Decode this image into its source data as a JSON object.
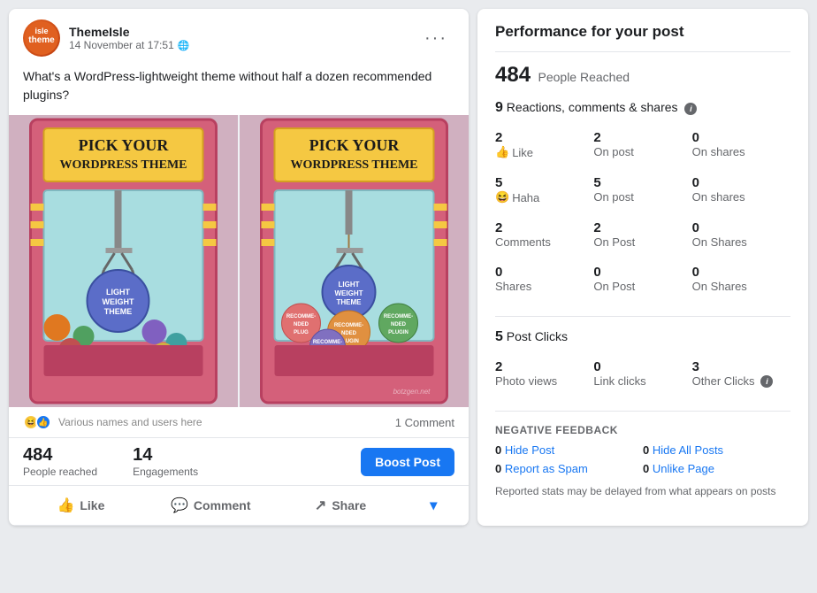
{
  "post": {
    "author": "ThemeIsle",
    "time": "14 November at 17:51",
    "text_line1": "What's a WordPress-lightweight theme without half a dozen recommended",
    "text_line2": "plugins?",
    "reach_number": "484",
    "reach_label": "People reached",
    "engagements_number": "14",
    "engagements_label": "Engagements",
    "boost_btn": "Boost Post",
    "comment_count": "1 Comment",
    "actions": {
      "like": "Like",
      "comment": "Comment",
      "share": "Share"
    }
  },
  "performance": {
    "title": "Performance for your post",
    "people_reached": "484",
    "people_reached_label": "People Reached",
    "reactions_count": "9",
    "reactions_label": "Reactions, comments & shares",
    "like_row": {
      "total": "2",
      "label": "Like",
      "on_post_num": "2",
      "on_post_label": "On post",
      "on_shares_num": "0",
      "on_shares_label": "On shares"
    },
    "haha_row": {
      "total": "5",
      "label": "Haha",
      "on_post_num": "5",
      "on_post_label": "On post",
      "on_shares_num": "0",
      "on_shares_label": "On shares"
    },
    "comments_row": {
      "total": "2",
      "label": "Comments",
      "on_post_num": "2",
      "on_post_label": "On Post",
      "on_shares_num": "0",
      "on_shares_label": "On Shares"
    },
    "shares_row": {
      "total": "0",
      "label": "Shares",
      "on_post_num": "0",
      "on_post_label": "On Post",
      "on_shares_num": "0",
      "on_shares_label": "On Shares"
    },
    "post_clicks_count": "5",
    "post_clicks_label": "Post Clicks",
    "photo_views_num": "2",
    "photo_views_label": "Photo views",
    "link_clicks_num": "0",
    "link_clicks_label": "Link clicks",
    "other_clicks_num": "3",
    "other_clicks_label": "Other Clicks",
    "negative_title": "NEGATIVE FEEDBACK",
    "hide_post_num": "0",
    "hide_post_label": "Hide Post",
    "hide_all_num": "0",
    "hide_all_label": "Hide All Posts",
    "spam_num": "0",
    "spam_label": "Report as Spam",
    "unlike_num": "0",
    "unlike_label": "Unlike Page",
    "footnote": "Reported stats may be delayed from what appears on posts"
  }
}
